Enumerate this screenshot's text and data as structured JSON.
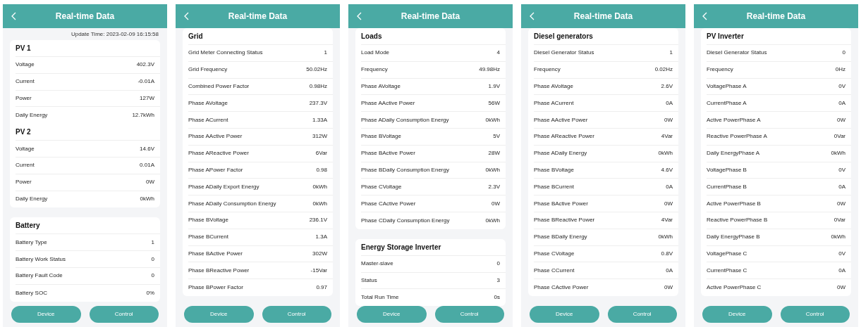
{
  "screens": [
    {
      "title": "Real-time Data",
      "update_time": "Update Time: 2023-02-09 16:15:58",
      "cards": [
        {
          "groups": [
            {
              "title": "PV 1",
              "rows": [
                {
                  "label": "Voltage",
                  "value": "402.3V"
                },
                {
                  "label": "Current",
                  "value": "-0.01A"
                },
                {
                  "label": "Power",
                  "value": "127W"
                },
                {
                  "label": "Daily Energy",
                  "value": "12.7kWh"
                }
              ]
            },
            {
              "title": "PV 2",
              "rows": [
                {
                  "label": "Voltage",
                  "value": "14.6V"
                },
                {
                  "label": "Current",
                  "value": "0.01A"
                },
                {
                  "label": "Power",
                  "value": "0W"
                },
                {
                  "label": "Daily Energy",
                  "value": "0kWh"
                }
              ]
            }
          ]
        },
        {
          "groups": [
            {
              "title": "Battery",
              "rows": [
                {
                  "label": "Battery Type",
                  "value": "1"
                },
                {
                  "label": "Battery Work Status",
                  "value": "0"
                },
                {
                  "label": "Battery Fault Code",
                  "value": "0"
                },
                {
                  "label": "Battery SOC",
                  "value": "0%"
                }
              ]
            }
          ]
        }
      ],
      "buttons": [
        "Device",
        "Control"
      ]
    },
    {
      "title": "Real-time Data",
      "cards": [
        {
          "groups": [
            {
              "title": "Grid",
              "rows": [
                {
                  "label": "Grid Meter Connecting Status",
                  "value": "1"
                },
                {
                  "label": "Grid Frequency",
                  "value": "50.02Hz"
                },
                {
                  "label": "Combined Power Factor",
                  "value": "0.98Hz"
                },
                {
                  "label": "Phase AVoltage",
                  "value": "237.3V"
                },
                {
                  "label": "Phase ACurrent",
                  "value": "1.33A"
                },
                {
                  "label": "Phase AActive Power",
                  "value": "312W"
                },
                {
                  "label": "Phase AReactive Power",
                  "value": "6Var"
                },
                {
                  "label": "Phase APower Factor",
                  "value": "0.98"
                },
                {
                  "label": "Phase ADaily Export Energy",
                  "value": "0kWh"
                },
                {
                  "label": "Phase ADaily Consumption Energy",
                  "value": "0kWh"
                },
                {
                  "label": "Phase BVoltage",
                  "value": "236.1V"
                },
                {
                  "label": "Phase BCurrent",
                  "value": "1.3A"
                },
                {
                  "label": "Phase BActive Power",
                  "value": "302W"
                },
                {
                  "label": "Phase BReactive Power",
                  "value": "-15Var"
                },
                {
                  "label": "Phase BPower Factor",
                  "value": "0.97"
                }
              ]
            }
          ]
        }
      ],
      "buttons": [
        "Device",
        "Control"
      ]
    },
    {
      "title": "Real-time Data",
      "cards": [
        {
          "groups": [
            {
              "title": "Loads",
              "rows": [
                {
                  "label": "Load Mode",
                  "value": "4"
                },
                {
                  "label": "Frequency",
                  "value": "49.98Hz"
                },
                {
                  "label": "Phase AVoltage",
                  "value": "1.9V"
                },
                {
                  "label": "Phase AActive Power",
                  "value": "56W"
                },
                {
                  "label": "Phase ADaily Consumption Energy",
                  "value": "0kWh"
                },
                {
                  "label": "Phase BVoltage",
                  "value": "5V"
                },
                {
                  "label": "Phase BActive Power",
                  "value": "28W"
                },
                {
                  "label": "Phase BDaily Consumption Energy",
                  "value": "0kWh"
                },
                {
                  "label": "Phase CVoltage",
                  "value": "2.3V"
                },
                {
                  "label": "Phase CActive Power",
                  "value": "0W"
                },
                {
                  "label": "Phase CDaily Consumption Energy",
                  "value": "0kWh"
                }
              ]
            }
          ]
        },
        {
          "groups": [
            {
              "title": "Energy Storage Inverter",
              "rows": [
                {
                  "label": "Master-slave",
                  "value": "0"
                },
                {
                  "label": "Status",
                  "value": "3"
                },
                {
                  "label": "Total Run Time",
                  "value": "0s"
                }
              ]
            }
          ]
        }
      ],
      "buttons": [
        "Device",
        "Control"
      ]
    },
    {
      "title": "Real-time Data",
      "cards": [
        {
          "groups": [
            {
              "title": "Diesel generators",
              "rows": [
                {
                  "label": "Diesel Generator Status",
                  "value": "1"
                },
                {
                  "label": "Frequency",
                  "value": "0.02Hz"
                },
                {
                  "label": "Phase AVoltage",
                  "value": "2.6V"
                },
                {
                  "label": "Phase ACurrent",
                  "value": "0A"
                },
                {
                  "label": "Phase AActive Power",
                  "value": "0W"
                },
                {
                  "label": "Phase AReactive Power",
                  "value": "4Var"
                },
                {
                  "label": "Phase ADaily Energy",
                  "value": "0kWh"
                },
                {
                  "label": "Phase BVoltage",
                  "value": "4.6V"
                },
                {
                  "label": "Phase BCurrent",
                  "value": "0A"
                },
                {
                  "label": "Phase BActive Power",
                  "value": "0W"
                },
                {
                  "label": "Phase BReactive Power",
                  "value": "4Var"
                },
                {
                  "label": "Phase BDaily Energy",
                  "value": "0kWh"
                },
                {
                  "label": "Phase CVoltage",
                  "value": "0.8V"
                },
                {
                  "label": "Phase CCurrent",
                  "value": "0A"
                },
                {
                  "label": "Phase CActive Power",
                  "value": "0W"
                }
              ]
            }
          ]
        }
      ],
      "buttons": [
        "Device",
        "Control"
      ]
    },
    {
      "title": "Real-time Data",
      "cards": [
        {
          "groups": [
            {
              "title": "PV Inverter",
              "rows": [
                {
                  "label": "Diesel Generator Status",
                  "value": "0"
                },
                {
                  "label": "Frequency",
                  "value": "0Hz"
                },
                {
                  "label": "VoltagePhase A",
                  "value": "0V"
                },
                {
                  "label": "CurrentPhase A",
                  "value": "0A"
                },
                {
                  "label": "Active PowerPhase A",
                  "value": "0W"
                },
                {
                  "label": "Reactive PowerPhase A",
                  "value": "0Var"
                },
                {
                  "label": "Daily EnergyPhase A",
                  "value": "0kWh"
                },
                {
                  "label": "VoltagePhase B",
                  "value": "0V"
                },
                {
                  "label": "CurrentPhase B",
                  "value": "0A"
                },
                {
                  "label": "Active PowerPhase B",
                  "value": "0W"
                },
                {
                  "label": "Reactive PowerPhase B",
                  "value": "0Var"
                },
                {
                  "label": "Daily EnergyPhase B",
                  "value": "0kWh"
                },
                {
                  "label": "VoltagePhase C",
                  "value": "0V"
                },
                {
                  "label": "CurrentPhase C",
                  "value": "0A"
                },
                {
                  "label": "Active PowerPhase C",
                  "value": "0W"
                }
              ]
            }
          ]
        }
      ],
      "buttons": [
        "Device",
        "Control"
      ]
    }
  ]
}
